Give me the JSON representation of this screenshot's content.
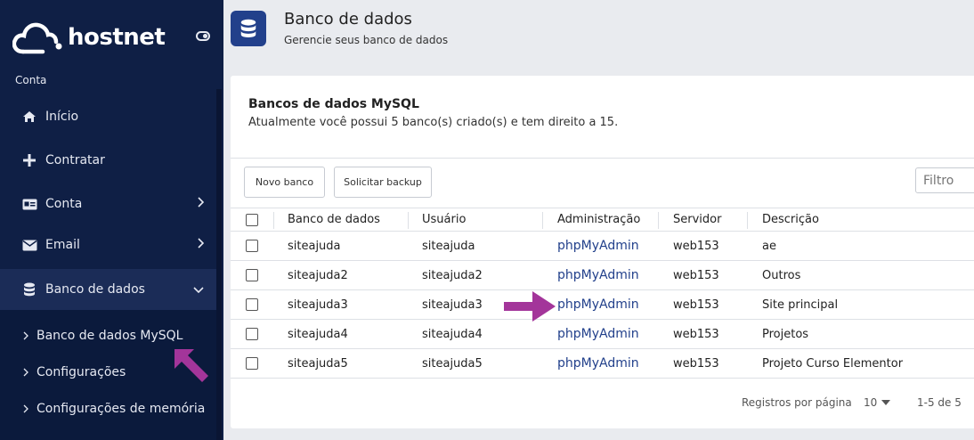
{
  "brand": {
    "name": "hostnet",
    "logo_icon": "cloud-icon"
  },
  "sidebar": {
    "section_label": "Conta",
    "items": [
      {
        "label": "Início",
        "icon": "home-icon",
        "has_chevron": false
      },
      {
        "label": "Contratar",
        "icon": "plus-icon",
        "has_chevron": false
      },
      {
        "label": "Conta",
        "icon": "id-card-icon",
        "has_chevron": true
      },
      {
        "label": "Email",
        "icon": "envelope-icon",
        "has_chevron": true
      },
      {
        "label": "Banco de dados",
        "icon": "database-icon",
        "has_chevron": true,
        "active": true
      }
    ],
    "subitems": [
      {
        "label": "Banco de dados MySQL"
      },
      {
        "label": "Configurações"
      },
      {
        "label": "Configurações de memória"
      }
    ]
  },
  "header": {
    "icon": "database-icon",
    "title": "Banco de dados",
    "subtitle": "Gerencie seus banco de dados"
  },
  "card": {
    "title": "Bancos de dados MySQL",
    "description": "Atualmente você possui 5 banco(s) criado(s) e tem direito a 15.",
    "buttons": {
      "new": "Novo banco",
      "backup": "Solicitar backup"
    },
    "filter_placeholder": "Filtro"
  },
  "table": {
    "columns": [
      "Banco de dados",
      "Usuário",
      "Administração",
      "Servidor",
      "Descrição"
    ],
    "rows": [
      {
        "db": "siteajuda",
        "user": "siteajuda",
        "admin": "phpMyAdmin",
        "server": "web153",
        "desc": "ae"
      },
      {
        "db": "siteajuda2",
        "user": "siteajuda2",
        "admin": "phpMyAdmin",
        "server": "web153",
        "desc": "Outros"
      },
      {
        "db": "siteajuda3",
        "user": "siteajuda3",
        "admin": "phpMyAdmin",
        "server": "web153",
        "desc": "Site principal"
      },
      {
        "db": "siteajuda4",
        "user": "siteajuda4",
        "admin": "phpMyAdmin",
        "server": "web153",
        "desc": "Projetos"
      },
      {
        "db": "siteajuda5",
        "user": "siteajuda5",
        "admin": "phpMyAdmin",
        "server": "web153",
        "desc": "Projeto Curso Elementor"
      }
    ]
  },
  "pagination": {
    "label": "Registros por página",
    "per_page": "10",
    "range": "1-5 de 5"
  },
  "colors": {
    "sidebar_bg": "#0f1f45",
    "accent": "#22408b",
    "annotation_arrow": "#a3359a"
  }
}
